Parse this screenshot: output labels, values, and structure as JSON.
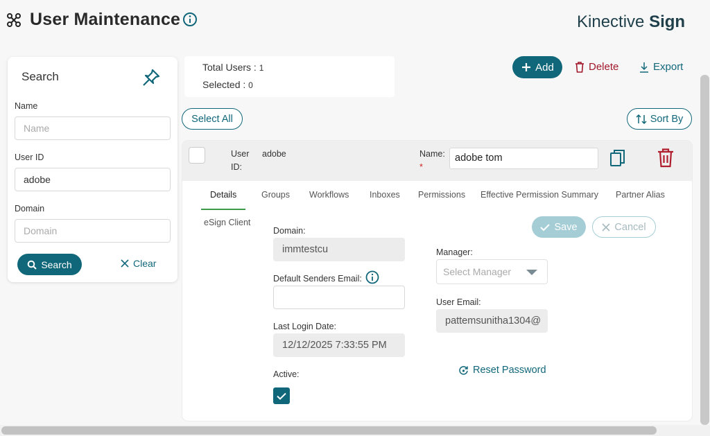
{
  "header": {
    "title": "User Maintenance",
    "brand_regular": "Kinective",
    "brand_bold": "Sign"
  },
  "search": {
    "title": "Search",
    "name_label": "Name",
    "name_placeholder": "Name",
    "name_value": "",
    "userid_label": "User ID",
    "userid_value": "adobe",
    "domain_label": "Domain",
    "domain_placeholder": "Domain",
    "domain_value": "",
    "search_button": "Search",
    "clear_button": "Clear"
  },
  "summary": {
    "total_label": "Total Users :",
    "total_value": "1",
    "selected_label": "Selected :",
    "selected_value": "0"
  },
  "toolbar": {
    "add": "Add",
    "delete": "Delete",
    "export": "Export",
    "select_all": "Select All",
    "sort_by": "Sort By"
  },
  "user": {
    "userid_label_1": "User",
    "userid_label_2": "ID:",
    "userid_value": "adobe",
    "name_label": "Name:",
    "name_required": "*",
    "name_value": "adobe tom"
  },
  "tabs": [
    {
      "label": "Details",
      "active": true
    },
    {
      "label": "Groups"
    },
    {
      "label": "Workflows"
    },
    {
      "label": "Inboxes"
    },
    {
      "label": "Permissions"
    },
    {
      "label": "Effective Permission Summary"
    },
    {
      "label": "Partner Alias"
    },
    {
      "label": "eSign Client"
    }
  ],
  "details": {
    "save": "Save",
    "cancel": "Cancel",
    "domain_label": "Domain:",
    "domain_value": "immtestcu",
    "default_email_label": "Default Senders Email:",
    "default_email_value": "",
    "last_login_label": "Last Login Date:",
    "last_login_value": "12/12/2025 7:33:55 PM",
    "active_label": "Active:",
    "active_checked": true,
    "manager_label": "Manager:",
    "manager_placeholder": "Select Manager",
    "user_email_label": "User Email:",
    "user_email_value": "pattemsunitha1304@",
    "reset_password": "Reset Password"
  },
  "colors": {
    "primary": "#11677a",
    "danger": "#a0182a",
    "active_tab": "#3e9a4a",
    "disabled": "#a5cdd6"
  }
}
